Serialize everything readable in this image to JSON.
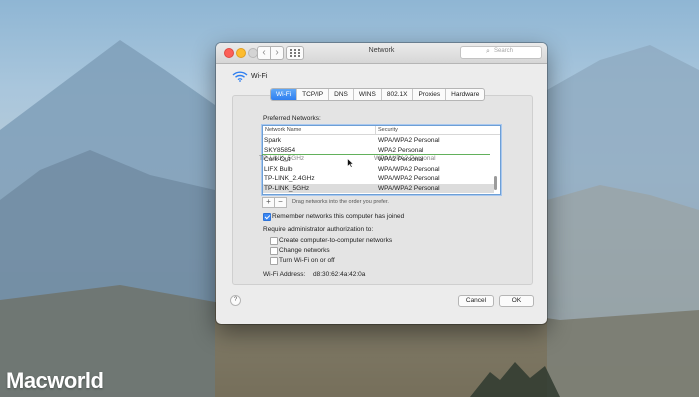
{
  "watermark": "Macworld",
  "window": {
    "title": "Network",
    "search_placeholder": "Search",
    "back_glyph": "‹",
    "forward_glyph": "›"
  },
  "service": {
    "name": "Wi-Fi",
    "icon": "wifi-icon"
  },
  "tabs": [
    {
      "label": "Wi-Fi",
      "active": true
    },
    {
      "label": "TCP/IP"
    },
    {
      "label": "DNS"
    },
    {
      "label": "WINS"
    },
    {
      "label": "802.1X"
    },
    {
      "label": "Proxies"
    },
    {
      "label": "Hardware"
    }
  ],
  "preferred": {
    "label": "Preferred Networks:",
    "columns": [
      "Network Name",
      "Security"
    ],
    "rows": [
      {
        "name": "Spark",
        "security": "WPA/WPA2 Personal"
      },
      {
        "name": "SKY85854",
        "security": "WPA2 Personal"
      },
      {
        "name": "Cork-Out",
        "security": "WPA2 Personal"
      },
      {
        "name": "LIFX Bulb",
        "security": "WPA/WPA2 Personal"
      },
      {
        "name": "TP-LINK_2.4GHz",
        "security": "WPA/WPA2 Personal"
      },
      {
        "name": "TP-LINK_5GHz",
        "security": "WPA/WPA2 Personal",
        "selected": true
      }
    ],
    "dragging": {
      "name": "TP-LINK_5GHz",
      "security": "WPA/WPA2 Personal"
    },
    "add_glyph": "+",
    "remove_glyph": "−",
    "drag_hint": "Drag networks into the order you prefer."
  },
  "remember": {
    "label": "Remember networks this computer has joined",
    "checked": true
  },
  "admin": {
    "label": "Require administrator authorization to:",
    "options": [
      {
        "label": "Create computer-to-computer networks",
        "checked": false
      },
      {
        "label": "Change networks",
        "checked": false
      },
      {
        "label": "Turn Wi-Fi on or off",
        "checked": false
      }
    ]
  },
  "wifi_address": {
    "label": "Wi-Fi Address:",
    "value": "d8:30:62:4a:42:0a"
  },
  "buttons": {
    "help": "?",
    "cancel": "Cancel",
    "ok": "OK"
  },
  "colors": {
    "accent": "#3b87f3",
    "insert_line": "#62b05b"
  }
}
